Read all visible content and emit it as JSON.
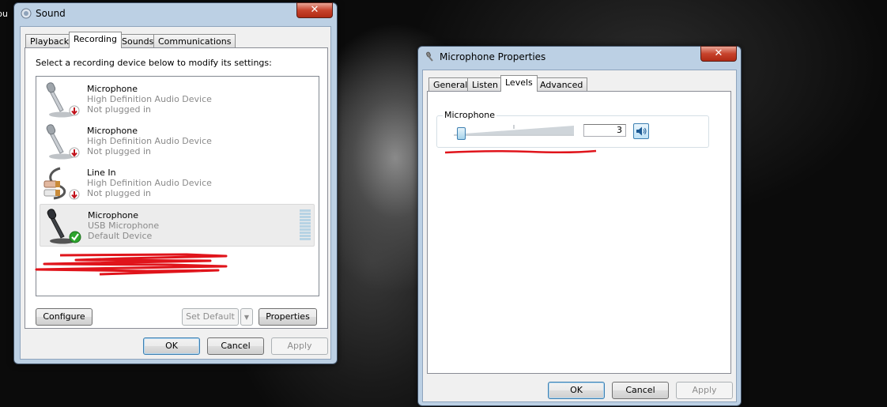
{
  "desktop": {
    "label": "pu"
  },
  "sound_window": {
    "title": "Sound",
    "close": "✕",
    "tabs": [
      "Playback",
      "Recording",
      "Sounds",
      "Communications"
    ],
    "active_tab": "Recording",
    "instruction": "Select a recording device below to modify its settings:",
    "devices": [
      {
        "name": "Microphone",
        "sub": "High Definition Audio Device",
        "status": "Not plugged in",
        "icon": "microphone-icon",
        "badge": "unplugged-arrow-icon"
      },
      {
        "name": "Microphone",
        "sub": "High Definition Audio Device",
        "status": "Not plugged in",
        "icon": "microphone-icon",
        "badge": "unplugged-arrow-icon"
      },
      {
        "name": "Line In",
        "sub": "High Definition Audio Device",
        "status": "Not plugged in",
        "icon": "line-in-cable-icon",
        "badge": "unplugged-arrow-icon"
      },
      {
        "name": "Microphone",
        "sub": "USB Microphone",
        "status": "Default Device",
        "icon": "microphone-icon",
        "badge": "default-check-icon",
        "selected": true
      }
    ],
    "buttons": {
      "configure": "Configure",
      "set_default": "Set Default",
      "properties": "Properties",
      "ok": "OK",
      "cancel": "Cancel",
      "apply": "Apply"
    }
  },
  "mic_window": {
    "title": "Microphone Properties",
    "close": "✕",
    "tabs": [
      "General",
      "Listen",
      "Levels",
      "Advanced"
    ],
    "active_tab": "Levels",
    "group_label": "Microphone",
    "level_value": "3",
    "slider_fraction": 0.03,
    "buttons": {
      "ok": "OK",
      "cancel": "Cancel",
      "apply": "Apply"
    }
  },
  "colors": {
    "redaction": "#e0141b",
    "window_frame": "#bcd0e4",
    "accent": "#3c7fb1"
  }
}
